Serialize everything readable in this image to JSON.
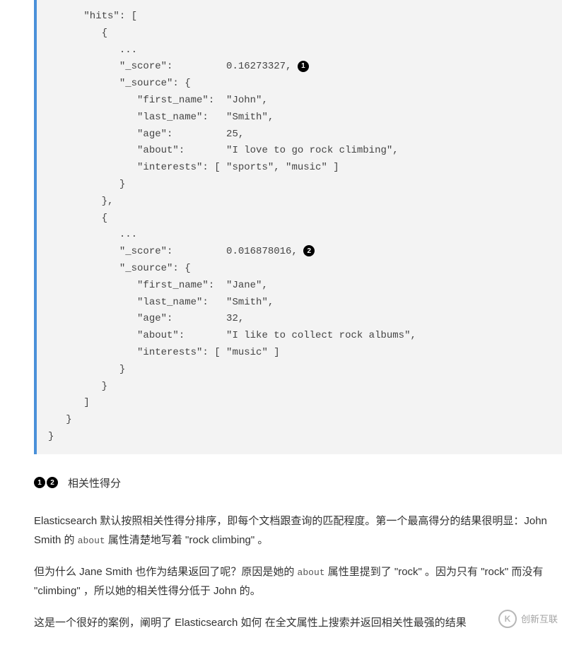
{
  "code_lines": [
    "      \"hits\": [",
    "         {",
    "            ...",
    "            \"_score\":         0.16273327, ①",
    "            \"_source\": {",
    "               \"first_name\":  \"John\",",
    "               \"last_name\":   \"Smith\",",
    "               \"age\":         25,",
    "               \"about\":       \"I love to go rock climbing\",",
    "               \"interests\": [ \"sports\", \"music\" ]",
    "            }",
    "         },",
    "         {",
    "            ...",
    "            \"_score\":         0.016878016, ②",
    "            \"_source\": {",
    "               \"first_name\":  \"Jane\",",
    "               \"last_name\":   \"Smith\",",
    "               \"age\":         32,",
    "               \"about\":       \"I like to collect rock albums\",",
    "               \"interests\": [ \"music\" ]",
    "            }",
    "         }",
    "      ]",
    "   }",
    "}"
  ],
  "callouts": {
    "one": "1",
    "two": "2"
  },
  "note_label": "相关性得分",
  "para1_a": "Elasticsearch 默认按照相关性得分排序，即每个文档跟查询的匹配程度。第一个最高得分的结果很明显：John Smith 的 ",
  "para1_code": "about",
  "para1_b": " 属性清楚地写着 \"rock climbing\" 。",
  "para2_a": "但为什么 Jane Smith 也作为结果返回了呢？原因是她的 ",
  "para2_code": "about",
  "para2_b": " 属性里提到了 \"rock\" 。因为只有 \"rock\" 而没有 \"climbing\" ，所以她的相关性得分低于 John 的。",
  "para3": "这是一个很好的案例，阐明了 Elasticsearch 如何 在全文属性上搜索并返回相关性最强的结果",
  "watermark": {
    "icon": "K",
    "text": "创新互联"
  }
}
